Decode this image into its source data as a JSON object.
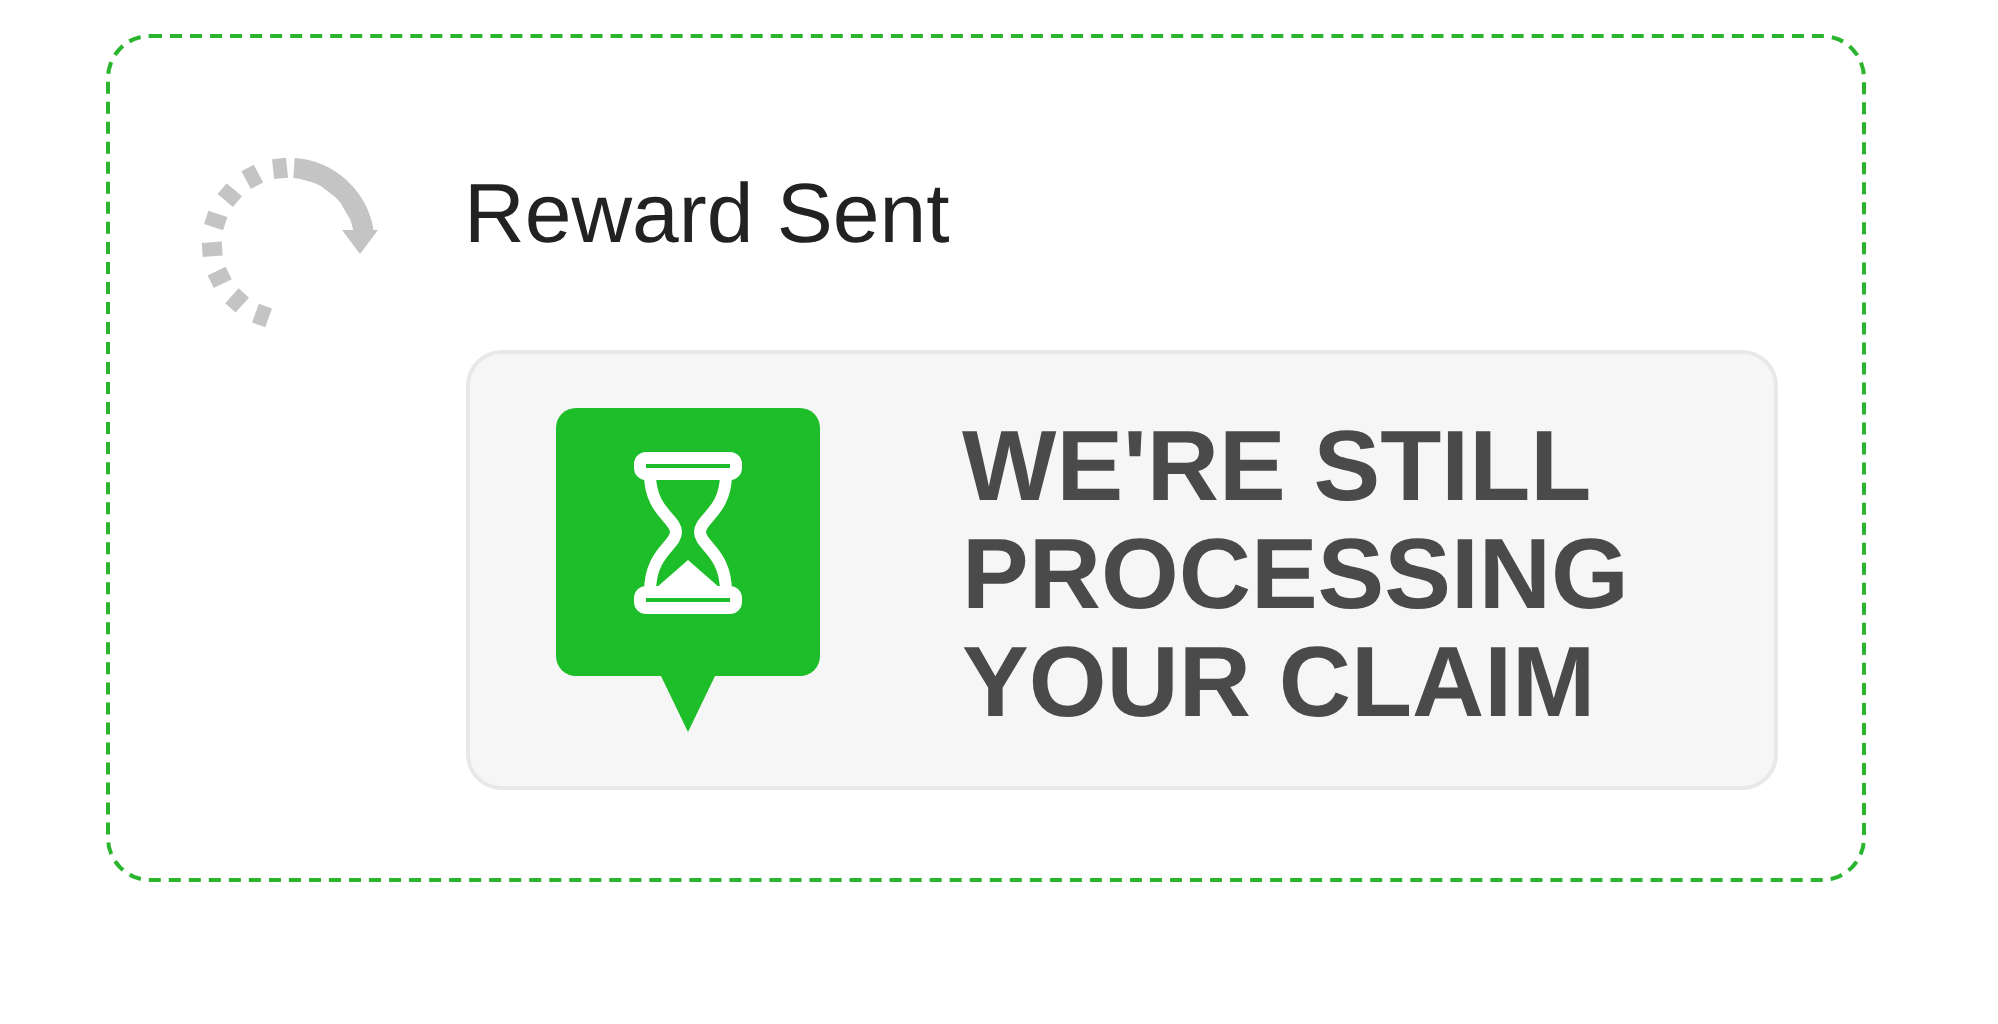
{
  "card": {
    "title": "Reward Sent",
    "notice": {
      "message": "WE'RE STILL\nPROCESSING\nYOUR CLAIM"
    }
  }
}
